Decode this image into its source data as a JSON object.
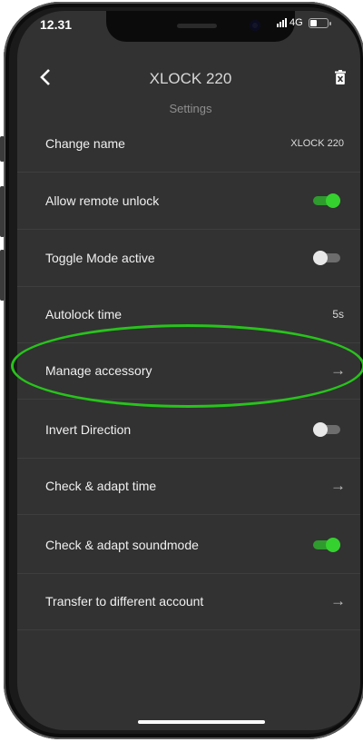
{
  "status_bar": {
    "time": "12.31",
    "network": "4G"
  },
  "header": {
    "title": "XLOCK 220",
    "subtitle": "Settings",
    "back_icon": "chevron-left-icon",
    "delete_icon": "trash-icon"
  },
  "settings": [
    {
      "label": "Change name",
      "value": "XLOCK 220",
      "control": "value"
    },
    {
      "label": "Allow remote unlock",
      "control": "toggle",
      "on": true
    },
    {
      "label": "Toggle Mode active",
      "control": "toggle",
      "on": false
    },
    {
      "label": "Autolock time",
      "value": "5s",
      "control": "value"
    },
    {
      "label": "Manage accessory",
      "control": "arrow",
      "highlighted": true
    },
    {
      "label": "Invert Direction",
      "control": "toggle",
      "on": false
    },
    {
      "label": "Check & adapt time",
      "control": "arrow"
    },
    {
      "label": "Check & adapt soundmode",
      "control": "toggle",
      "on": true
    },
    {
      "label": "Transfer to different account",
      "control": "arrow"
    }
  ],
  "colors": {
    "background": "#323232",
    "toggle_on": "#35d12f",
    "toggle_off": "#e8e8e8",
    "highlight_ring": "#28c31c"
  },
  "arrow_glyph": "→"
}
